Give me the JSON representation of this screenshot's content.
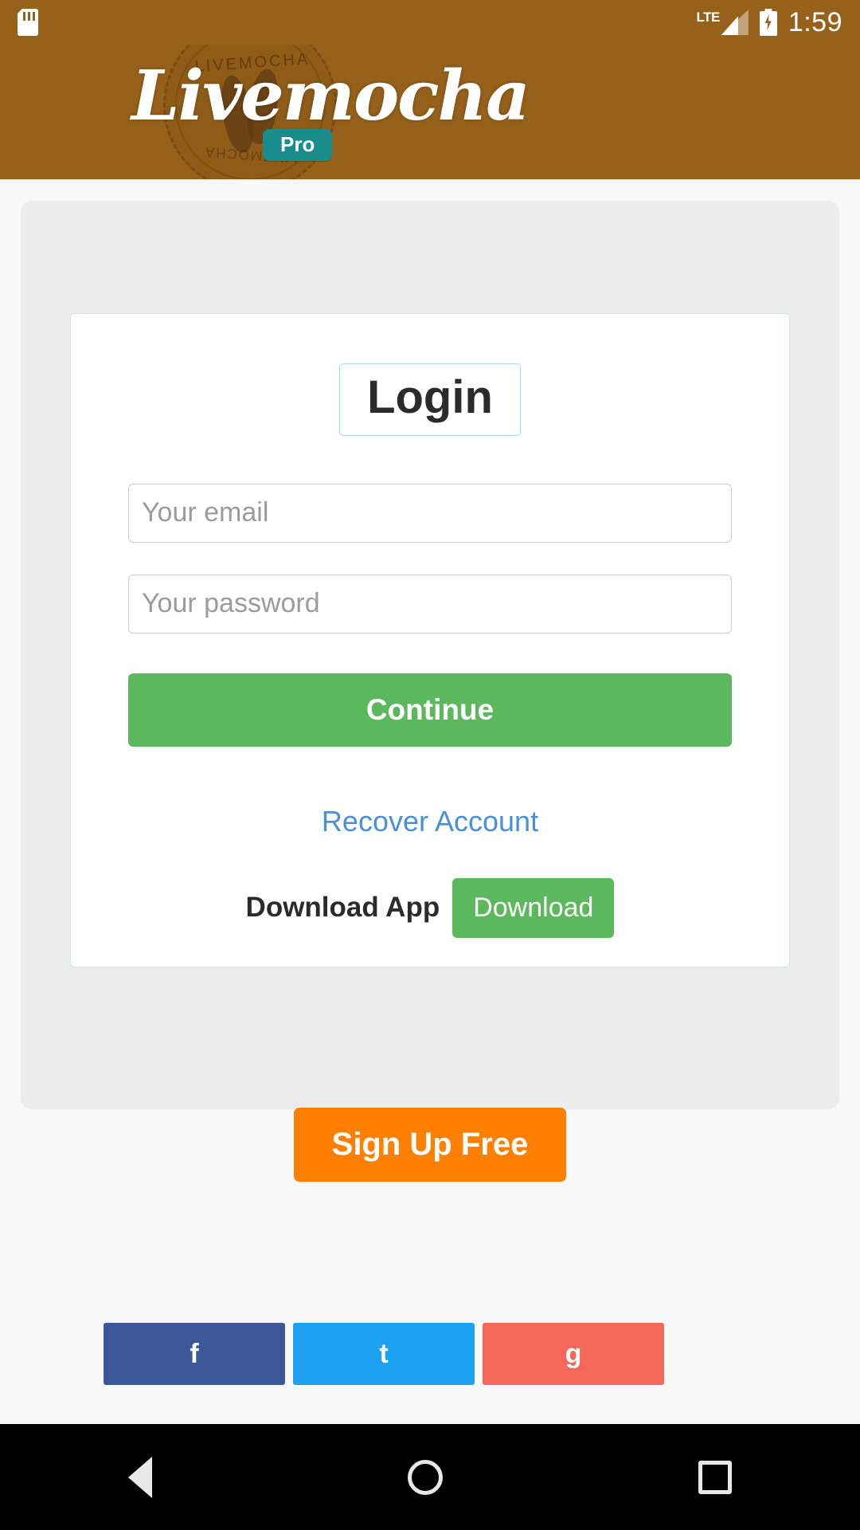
{
  "status_bar": {
    "sd_icon": "sd-card-icon",
    "network_type": "LTE",
    "signal_icon": "signal-bars-icon",
    "battery_icon": "battery-charging-icon",
    "time": "1:59"
  },
  "header": {
    "brand_name": "Livemocha",
    "badge": "Pro",
    "stamp_top_text": "LIVEMOCHA",
    "stamp_bottom_text": "LIVEMOCHA",
    "background_color": "#96611a",
    "badge_color": "#1b8c8c"
  },
  "login": {
    "title": "Login",
    "email": {
      "placeholder": "Your email",
      "value": ""
    },
    "password": {
      "placeholder": "Your password",
      "value": ""
    },
    "continue_label": "Continue",
    "continue_color": "#5cb85c",
    "recover_label": "Recover Account",
    "recover_color": "#4a90d9",
    "download_app_label": "Download App",
    "download_button_label": "Download"
  },
  "signup": {
    "label": "Sign Up Free",
    "color": "#ff8000"
  },
  "social": [
    {
      "name": "Facebook",
      "glyph": "f",
      "color": "#3b5998"
    },
    {
      "name": "Twitter",
      "glyph": "t",
      "color": "#1da1f2"
    },
    {
      "name": "Google+",
      "glyph": "g",
      "color": "#f4685a"
    }
  ],
  "navbar": {
    "back": "back-icon",
    "home": "home-icon",
    "recents": "recents-icon"
  }
}
